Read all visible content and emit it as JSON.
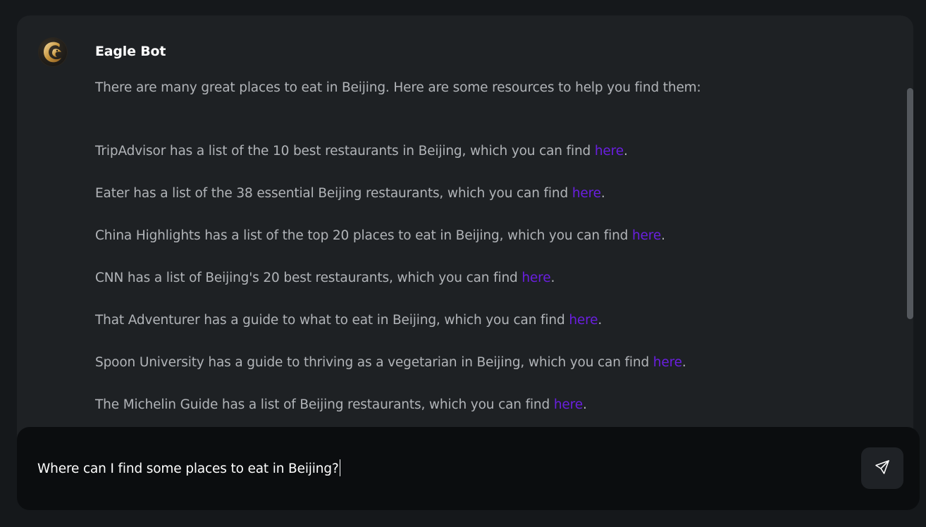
{
  "bot": {
    "name": "Eagle Bot",
    "avatar_icon": "eagle-logo-icon"
  },
  "message": {
    "intro": "There are many great places to eat in Beijing. Here are some resources to help you find them:",
    "items": [
      {
        "text": "TripAdvisor has a list of the 10 best restaurants in Beijing, which you can find ",
        "link": "here",
        "suffix": "."
      },
      {
        "text": "Eater has a list of the 38 essential Beijing restaurants, which you can find ",
        "link": "here",
        "suffix": "."
      },
      {
        "text": "China Highlights has a list of the top 20 places to eat in Beijing, which you can find ",
        "link": "here",
        "suffix": "."
      },
      {
        "text": "CNN has a list of Beijing's 20 best restaurants, which you can find ",
        "link": "here",
        "suffix": "."
      },
      {
        "text": "That Adventurer has a guide to what to eat in Beijing, which you can find ",
        "link": "here",
        "suffix": "."
      },
      {
        "text": "Spoon University has a guide to thriving as a vegetarian in Beijing, which you can find ",
        "link": "here",
        "suffix": "."
      },
      {
        "text": "The Michelin Guide has a list of Beijing restaurants, which you can find ",
        "link": "here",
        "suffix": "."
      }
    ]
  },
  "input": {
    "value": "Where can I find some places to eat in Beijing?",
    "send_icon": "send-icon"
  },
  "colors": {
    "background": "#15181b",
    "panel": "#1e2124",
    "input_bar": "#0b0d0f",
    "text": "#b1b4b8",
    "link": "#6a1fe0"
  }
}
